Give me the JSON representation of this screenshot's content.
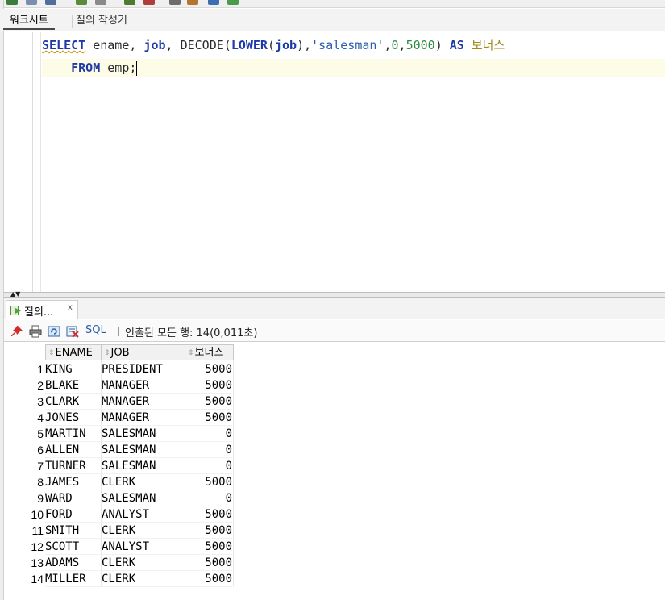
{
  "worksheet": {
    "tabs": [
      {
        "label": "워크시트",
        "active": true
      },
      {
        "label": "질의 작성기",
        "active": false
      }
    ]
  },
  "editor": {
    "line1": {
      "select": "SELECT",
      "ename": " ename, ",
      "job": "job",
      "comma1": ", DECODE(",
      "lower": "LOWER",
      "paren_open": "(",
      "job2": "job",
      "paren_close": "),",
      "salesman": "'salesman'",
      "comma2": ",",
      "zero": "0",
      "comma3": ",",
      "five_thousand": "5000",
      "paren_end": ") ",
      "as": "AS",
      "space": " ",
      "alias": "보너스"
    },
    "line2": {
      "indent": "    ",
      "from": "FROM",
      "rest": " emp;"
    }
  },
  "result_tab": {
    "label": "질의...",
    "close": "x"
  },
  "result_toolbar": {
    "sql_label": "SQL",
    "status": "인출된 모든 행: 14(0,011초)"
  },
  "grid": {
    "columns": [
      "ENAME",
      "JOB",
      "보너스"
    ],
    "rows": [
      {
        "n": "1",
        "ename": "KING",
        "job": "PRESIDENT",
        "bonus": "5000"
      },
      {
        "n": "2",
        "ename": "BLAKE",
        "job": "MANAGER",
        "bonus": "5000"
      },
      {
        "n": "3",
        "ename": "CLARK",
        "job": "MANAGER",
        "bonus": "5000"
      },
      {
        "n": "4",
        "ename": "JONES",
        "job": "MANAGER",
        "bonus": "5000"
      },
      {
        "n": "5",
        "ename": "MARTIN",
        "job": "SALESMAN",
        "bonus": "0"
      },
      {
        "n": "6",
        "ename": "ALLEN",
        "job": "SALESMAN",
        "bonus": "0"
      },
      {
        "n": "7",
        "ename": "TURNER",
        "job": "SALESMAN",
        "bonus": "0"
      },
      {
        "n": "8",
        "ename": "JAMES",
        "job": "CLERK",
        "bonus": "5000"
      },
      {
        "n": "9",
        "ename": "WARD",
        "job": "SALESMAN",
        "bonus": "0"
      },
      {
        "n": "10",
        "ename": "FORD",
        "job": "ANALYST",
        "bonus": "5000"
      },
      {
        "n": "11",
        "ename": "SMITH",
        "job": "CLERK",
        "bonus": "5000"
      },
      {
        "n": "12",
        "ename": "SCOTT",
        "job": "ANALYST",
        "bonus": "5000"
      },
      {
        "n": "13",
        "ename": "ADAMS",
        "job": "CLERK",
        "bonus": "5000"
      },
      {
        "n": "14",
        "ename": "MILLER",
        "job": "CLERK",
        "bonus": "5000"
      }
    ]
  },
  "colors": {
    "keyword": "#1e3aa8",
    "string": "#2b5fae",
    "number": "#2b8a3e",
    "alias": "#a08a18",
    "current_line": "#fdfce6"
  }
}
